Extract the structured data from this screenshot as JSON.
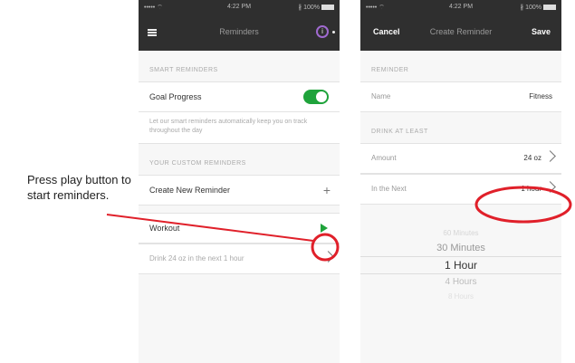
{
  "callout": {
    "text": "Press play button to start reminders."
  },
  "status": {
    "carrier": "••••• ⌔",
    "time": "4:22 PM",
    "battery": "∦ 100%"
  },
  "left": {
    "title": "Reminders",
    "smart_header": "SMART REMINDERS",
    "goal_label": "Goal Progress",
    "goal_on": true,
    "goal_desc": "Let our smart reminders automatically keep you on track throughout the day",
    "custom_header": "YOUR CUSTOM REMINDERS",
    "create_label": "Create New Reminder",
    "workout_label": "Workout",
    "drink_label": "Drink 24 oz in the next 1 hour"
  },
  "right": {
    "cancel": "Cancel",
    "title": "Create Reminder",
    "save": "Save",
    "reminder_header": "REMINDER",
    "name_label": "Name",
    "name_value": "Fitness",
    "drink_header": "DRINK AT LEAST",
    "amount_label": "Amount",
    "amount_value": "24 oz",
    "next_label": "In the Next",
    "next_value": "1 hour",
    "picker": [
      "60 Minutes",
      "30 Minutes",
      "1 Hour",
      "4 Hours",
      "8 Hours"
    ]
  },
  "colors": {
    "accent_green": "#1fa33b",
    "annotation_red": "#e0202a",
    "topbar": "#2f2f2f"
  }
}
